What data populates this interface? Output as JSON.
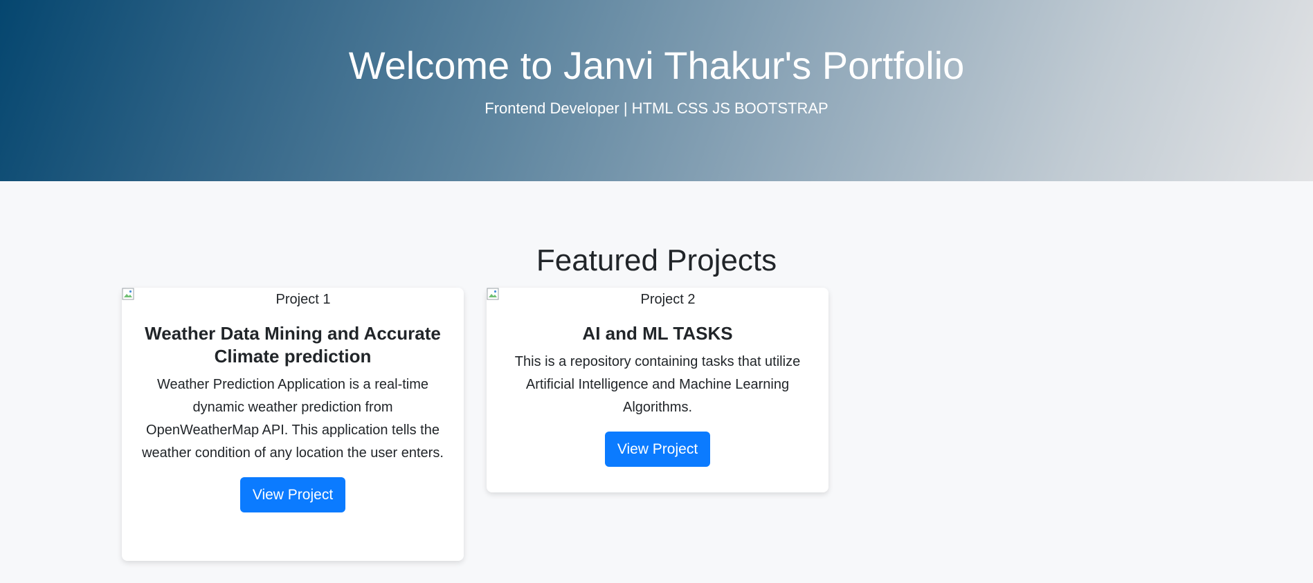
{
  "hero": {
    "title": "Welcome to Janvi Thakur's Portfolio",
    "subtitle": "Frontend Developer | HTML CSS JS BOOTSTRAP"
  },
  "projects_section": {
    "title": "Featured Projects",
    "cards": [
      {
        "image_alt": "Project 1",
        "title": "Weather Data Mining and Accurate Climate prediction",
        "description": "Weather Prediction Application is a real-time dynamic weather prediction from OpenWeatherMap API. This application tells the weather condition of any location the user enters.",
        "button_label": "View Project"
      },
      {
        "image_alt": "Project 2",
        "title": "AI and ML TASKS",
        "description": "This is a repository containing tasks that utilize Artificial Intelligence and Machine Learning Algorithms.",
        "button_label": "View Project"
      }
    ]
  },
  "colors": {
    "button": "#0b7bff",
    "hero_gradient_start": "#05466f",
    "hero_gradient_end": "#e2e3e5",
    "page_background": "#f7f8fa"
  },
  "icons": {
    "card_image": "broken-image-icon"
  }
}
